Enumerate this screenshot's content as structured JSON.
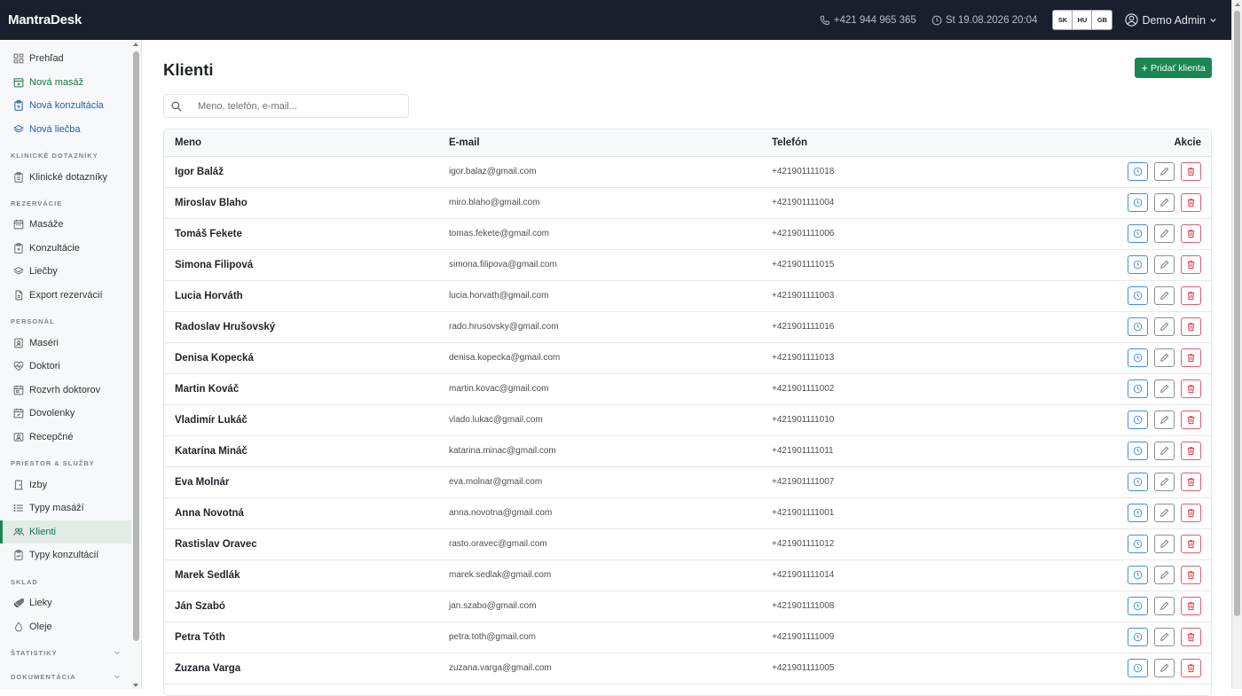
{
  "app": {
    "brand": "MantraDesk",
    "phone": "+421 944 965 365",
    "datetime": "St 19.08.2026 20:04",
    "languages": [
      "SK",
      "HU",
      "GB"
    ],
    "user": "Demo Admin"
  },
  "sidebar": {
    "top_items": [
      {
        "label": "Prehľad",
        "icon": "dashboard-icon"
      },
      {
        "label": "Nová masáž",
        "icon": "calendar-plus-icon"
      },
      {
        "label": "Nová konzultácia",
        "icon": "clipboard-icon"
      },
      {
        "label": "Nová liečba",
        "icon": "layers-icon"
      }
    ],
    "sections": [
      {
        "title": "Klinické dotazníky",
        "items": [
          {
            "label": "Klinické dotazníky",
            "icon": "clipboard-icon"
          }
        ]
      },
      {
        "title": "Rezervácie",
        "items": [
          {
            "label": "Masáže",
            "icon": "calendar-icon"
          },
          {
            "label": "Konzultácie",
            "icon": "clipboard-icon"
          },
          {
            "label": "Liečby",
            "icon": "layers-icon"
          },
          {
            "label": "Export rezervácií",
            "icon": "export-icon"
          }
        ]
      },
      {
        "title": "Personál",
        "items": [
          {
            "label": "Maséri",
            "icon": "badge-icon"
          },
          {
            "label": "Doktori",
            "icon": "heart-pulse-icon"
          },
          {
            "label": "Rozvrh doktorov",
            "icon": "calendar-icon"
          },
          {
            "label": "Dovolenky",
            "icon": "calendar-icon"
          },
          {
            "label": "Recepčné",
            "icon": "person-badge-icon"
          }
        ]
      },
      {
        "title": "Priestor & služby",
        "items": [
          {
            "label": "Izby",
            "icon": "door-icon"
          },
          {
            "label": "Typy masáží",
            "icon": "list-icon"
          },
          {
            "label": "Klienti",
            "icon": "people-icon",
            "active": true
          },
          {
            "label": "Typy konzultácií",
            "icon": "clipboard-icon"
          }
        ]
      },
      {
        "title": "Sklad",
        "items": [
          {
            "label": "Lieky",
            "icon": "capsule-icon"
          },
          {
            "label": "Oleje",
            "icon": "droplet-icon"
          }
        ]
      }
    ],
    "collapsed_sections": [
      "Štatistiky",
      "Dokumentácia"
    ]
  },
  "main": {
    "title": "Klienti",
    "add_button": "Pridať klienta",
    "search_placeholder": "Meno, telefón, e-mail...",
    "columns": {
      "name": "Meno",
      "email": "E-mail",
      "phone": "Telefón",
      "actions": "Akcie"
    },
    "clients": [
      {
        "name": "Igor Baláž",
        "email": "igor.balaz@gmail.com",
        "phone": "+421901111018"
      },
      {
        "name": "Miroslav Blaho",
        "email": "miro.blaho@gmail.com",
        "phone": "+421901111004"
      },
      {
        "name": "Tomáš Fekete",
        "email": "tomas.fekete@gmail.com",
        "phone": "+421901111006"
      },
      {
        "name": "Simona Filipová",
        "email": "simona.filipova@gmail.com",
        "phone": "+421901111015"
      },
      {
        "name": "Lucia Horváth",
        "email": "lucia.horvath@gmail.com",
        "phone": "+421901111003"
      },
      {
        "name": "Radoslav Hrušovský",
        "email": "rado.hrusovsky@gmail.com",
        "phone": "+421901111016"
      },
      {
        "name": "Denisa Kopecká",
        "email": "denisa.kopecka@gmail.com",
        "phone": "+421901111013"
      },
      {
        "name": "Martin Kováč",
        "email": "martin.kovac@gmail.com",
        "phone": "+421901111002"
      },
      {
        "name": "Vladimír Lukáč",
        "email": "vlado.lukac@gmail.com",
        "phone": "+421901111010"
      },
      {
        "name": "Katarína Mináč",
        "email": "katarina.minac@gmail.com",
        "phone": "+421901111011"
      },
      {
        "name": "Eva Molnár",
        "email": "eva.molnar@gmail.com",
        "phone": "+421901111007"
      },
      {
        "name": "Anna Novotná",
        "email": "anna.novotna@gmail.com",
        "phone": "+421901111001"
      },
      {
        "name": "Rastislav Oravec",
        "email": "rasto.oravec@gmail.com",
        "phone": "+421901111012"
      },
      {
        "name": "Marek Sedlák",
        "email": "marek.sedlak@gmail.com",
        "phone": "+421901111014"
      },
      {
        "name": "Ján Szabó",
        "email": "jan.szabo@gmail.com",
        "phone": "+421901111008"
      },
      {
        "name": "Petra Tóth",
        "email": "petra.toth@gmail.com",
        "phone": "+421901111009"
      },
      {
        "name": "Zuzana Varga",
        "email": "zuzana.varga@gmail.com",
        "phone": "+421901111005"
      }
    ]
  },
  "colors": {
    "topbar": "#1b1e2c",
    "accent": "#198754",
    "history": "#3d8bfd",
    "delete": "#dc3545"
  }
}
